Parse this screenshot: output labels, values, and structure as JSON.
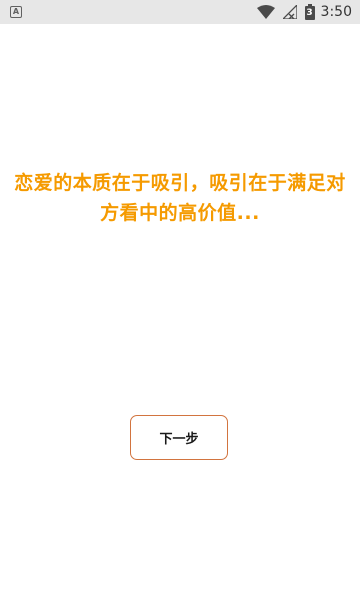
{
  "status_bar": {
    "notification_icon": "A",
    "battery_level": "3",
    "time": "3:50",
    "icons": [
      "notification-icon",
      "wifi-icon",
      "no-signal-icon",
      "battery-icon"
    ]
  },
  "main": {
    "headline": "恋爱的本质在于吸引，吸引在于满足对方看中的高价值...",
    "next_button_label": "下一步"
  },
  "colors": {
    "headline": "#f59a00",
    "button_border": "#d2743f",
    "status_bar_bg": "#e7e7e7"
  }
}
